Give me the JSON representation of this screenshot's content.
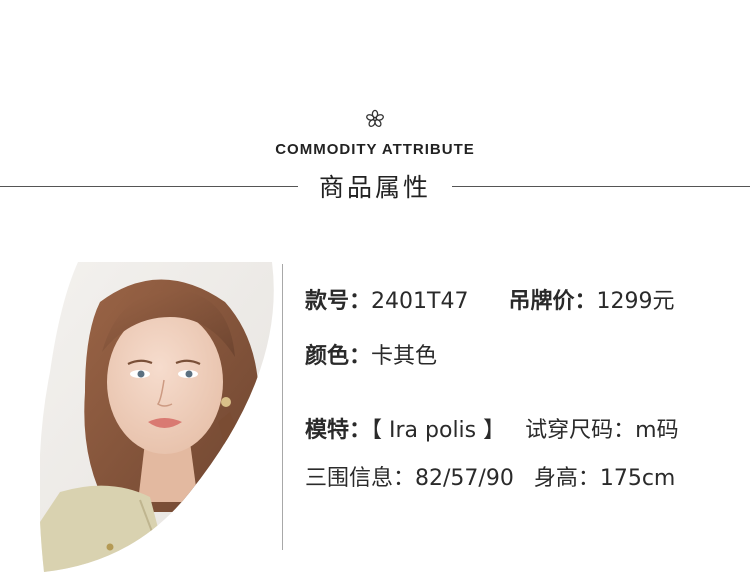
{
  "header": {
    "title_en": "COMMODITY ATTRIBUTE",
    "title_cn": "商品属性",
    "icon": "flower-icon"
  },
  "attributes": {
    "style_no": {
      "label": "款号：",
      "value": "2401T47"
    },
    "tag_price": {
      "label": "吊牌价：",
      "value": "1299元"
    },
    "color": {
      "label": "颜色：",
      "value": "卡其色"
    },
    "model": {
      "label": "模特：",
      "value": "【 Ira polis 】"
    },
    "trial_size": {
      "label": "试穿尺码：",
      "value": "m码"
    },
    "measurements": {
      "label": "三围信息：",
      "value": "82/57/90"
    },
    "height": {
      "label": "身高：",
      "value": "175cm"
    }
  },
  "colors": {
    "text": "#2a2a2a",
    "divider": "#a8a8a8",
    "coat": "#d9d2b0",
    "hair": "#8b5a3c"
  }
}
